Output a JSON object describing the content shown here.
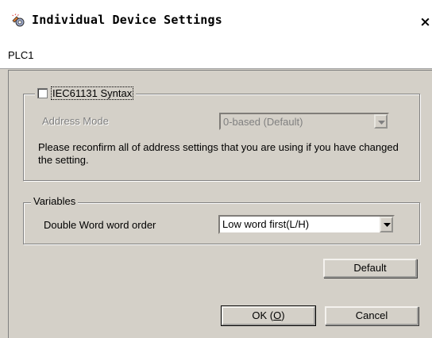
{
  "window": {
    "title": "Individual Device Settings",
    "icon": "device-settings-icon",
    "close_label": "×"
  },
  "device": {
    "name": "PLC1"
  },
  "iec_group": {
    "checkbox_label": "IEC61131 Syntax",
    "checked": false,
    "address_mode_label": "Address Mode",
    "address_mode_value": "0-based (Default)",
    "note": "Please reconfirm all of address settings that you are using if you have changed the setting."
  },
  "variables_group": {
    "title": "Variables",
    "dword_order_label": "Double Word word order",
    "dword_order_value": "Low word first(L/H)"
  },
  "buttons": {
    "default_label": "Default",
    "ok_label_prefix": "OK (",
    "ok_mnemonic": "O",
    "ok_label_suffix": ")",
    "cancel_label": "Cancel"
  }
}
